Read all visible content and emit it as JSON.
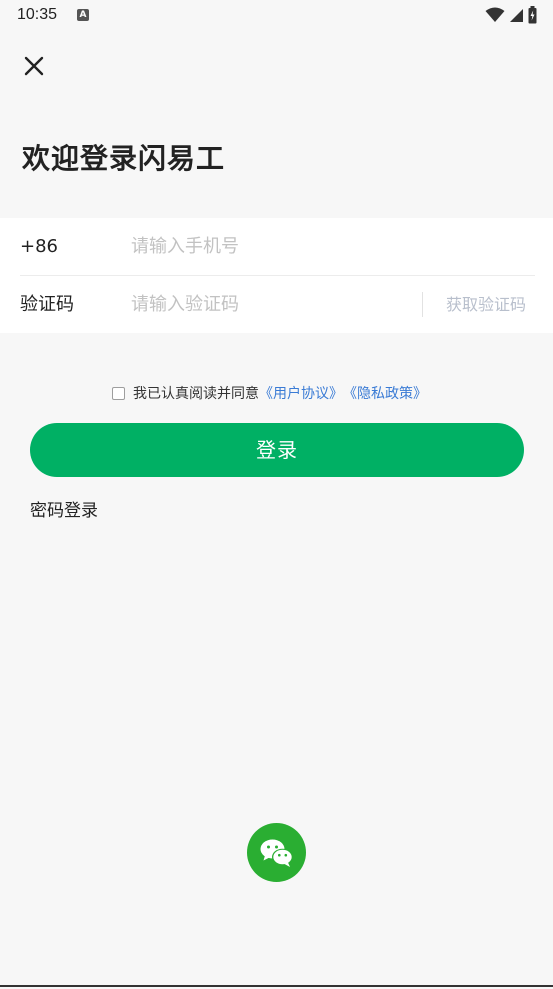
{
  "status_bar": {
    "time": "10:35",
    "notification_icon_letter": "A",
    "icons": [
      "wifi-icon",
      "signal-icon",
      "battery-icon"
    ]
  },
  "header": {
    "close_icon": "close-icon",
    "title": "欢迎登录闪易工"
  },
  "form": {
    "phone": {
      "country_code": "+86",
      "placeholder": "请输入手机号",
      "value": ""
    },
    "code": {
      "label": "验证码",
      "placeholder": "请输入验证码",
      "value": "",
      "get_code_label": "获取验证码"
    }
  },
  "agreement": {
    "checked": false,
    "prefix": "我已认真阅读并同意",
    "user_agreement": "《用户协议》",
    "privacy_policy": "《隐私政策》"
  },
  "actions": {
    "login_label": "登录",
    "password_login_label": "密码登录"
  },
  "third_party": {
    "wechat_icon": "wechat-icon"
  },
  "colors": {
    "primary": "#00b064",
    "wechat": "#2aae32",
    "link": "#3a7bd5",
    "placeholder": "#c2c2c2",
    "background": "#f7f7f7"
  }
}
